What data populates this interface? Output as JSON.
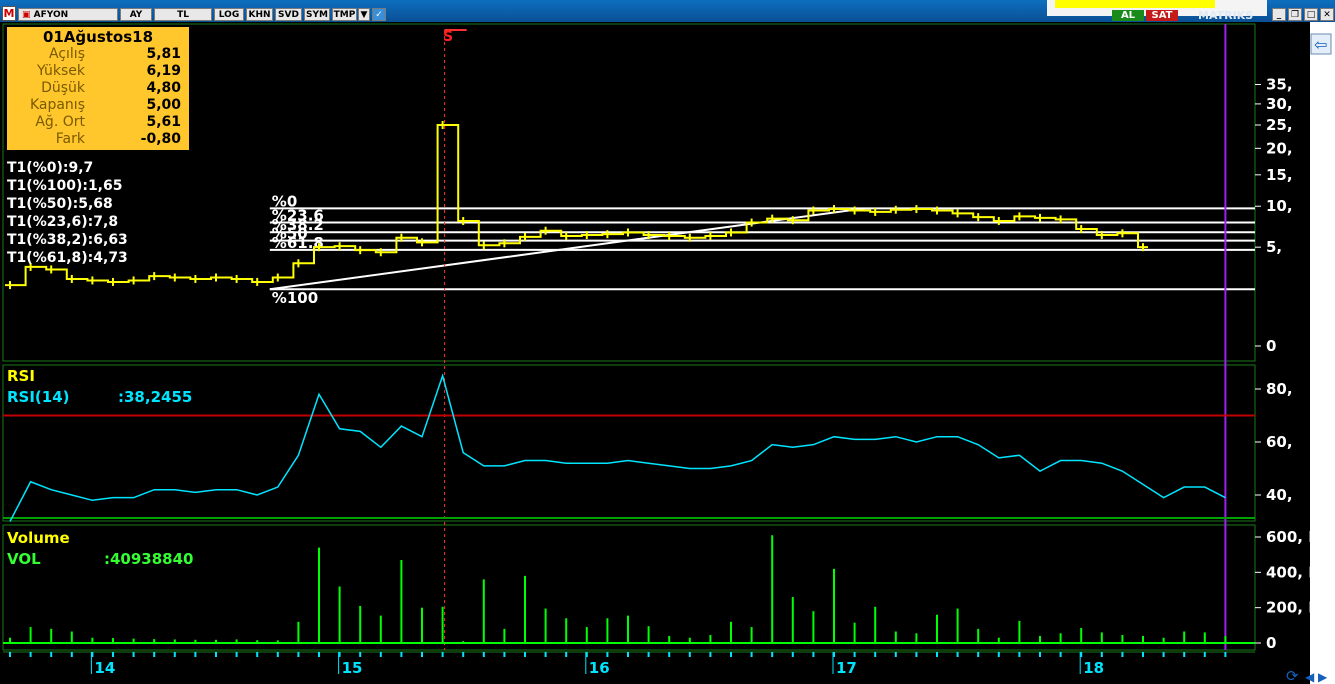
{
  "toolbar": {
    "logo": "M",
    "symbol": "AFYON",
    "period": "AY",
    "currency": "TL",
    "buttons": [
      "LOG",
      "KHN",
      "SVD",
      "SYM",
      "TMP"
    ],
    "buy_label": "AL",
    "sell_label": "SAT",
    "brand": "MATRIKS"
  },
  "info": {
    "title": "01Ağustos18",
    "rows": [
      {
        "label": "Açılış",
        "value": "5,81"
      },
      {
        "label": "Yüksek",
        "value": "6,19"
      },
      {
        "label": "Düşük",
        "value": "4,80"
      },
      {
        "label": "Kapanış",
        "value": "5,00"
      },
      {
        "label": "Ağ. Ort",
        "value": "5,61"
      },
      {
        "label": "Fark",
        "value": "-0,80"
      }
    ]
  },
  "fib_labels": [
    "T1(%0):9,7",
    "T1(%100):1,65",
    "T1(%50):5,68",
    "T1(%23,6):7,8",
    "T1(%38,2):6,63",
    "T1(%61,8):4,73"
  ],
  "fib_line_labels": [
    "%0",
    "%23.6",
    "%38.2",
    "%50",
    "%61.8",
    "%100"
  ],
  "marker_label": "S",
  "chart_data": [
    {
      "type": "line",
      "title": "",
      "price_axis_ticks": [
        "35,",
        "30,",
        "25,",
        "20,",
        "15,",
        "10,",
        "5,",
        "0"
      ],
      "x_ticks": [
        "14",
        "15",
        "16",
        "17",
        "18"
      ],
      "fib_levels": [
        9.7,
        7.8,
        6.63,
        5.68,
        4.73,
        1.65
      ],
      "fib_start_index": 13,
      "fib_end_index": 41,
      "marker_index": 21,
      "price_close": [
        1.9,
        3.2,
        3.0,
        2.3,
        2.2,
        2.1,
        2.2,
        2.5,
        2.4,
        2.3,
        2.4,
        2.3,
        2.1,
        2.4,
        3.5,
        5.0,
        5.1,
        4.7,
        4.5,
        6.0,
        5.5,
        25.0,
        8.0,
        5.2,
        5.4,
        6.1,
        6.8,
        6.2,
        6.3,
        6.4,
        6.6,
        6.3,
        6.2,
        6.0,
        6.2,
        6.6,
        7.8,
        8.3,
        8.1,
        9.4,
        9.6,
        9.4,
        9.2,
        9.5,
        9.6,
        9.4,
        9.0,
        8.5,
        8.0,
        8.6,
        8.4,
        8.2,
        7.0,
        6.3,
        6.5,
        5.0
      ],
      "rsi_title": "RSI",
      "rsi_name": "RSI(14)",
      "rsi_value": ":38,2455",
      "rsi_ticks": [
        "80,",
        "60,",
        "40,"
      ],
      "rsi_level": 70,
      "rsi": [
        30,
        45,
        42,
        40,
        38,
        39,
        39,
        42,
        42,
        41,
        42,
        42,
        40,
        43,
        55,
        78,
        65,
        64,
        58,
        66,
        62,
        85,
        56,
        51,
        51,
        53,
        53,
        52,
        52,
        52,
        53,
        52,
        51,
        50,
        50,
        51,
        53,
        59,
        58,
        59,
        62,
        61,
        61,
        62,
        60,
        62,
        62,
        59,
        54,
        55,
        49,
        53,
        53,
        52,
        49,
        44,
        39,
        43,
        43,
        39
      ],
      "vol_title": "Volume",
      "vol_name": "VOL",
      "vol_value": ":40938840",
      "vol_ticks": [
        "600, M",
        "400, M",
        "200, M",
        "0"
      ],
      "volume": [
        30,
        90,
        80,
        65,
        30,
        28,
        25,
        22,
        20,
        18,
        18,
        20,
        16,
        15,
        120,
        540,
        320,
        210,
        155,
        470,
        200,
        205,
        10,
        360,
        80,
        380,
        195,
        140,
        90,
        140,
        155,
        95,
        40,
        30,
        45,
        120,
        90,
        610,
        260,
        180,
        420,
        115,
        205,
        65,
        55,
        160,
        195,
        80,
        30,
        125,
        40,
        55,
        85,
        60,
        45,
        40,
        30,
        65,
        60,
        40
      ]
    }
  ]
}
